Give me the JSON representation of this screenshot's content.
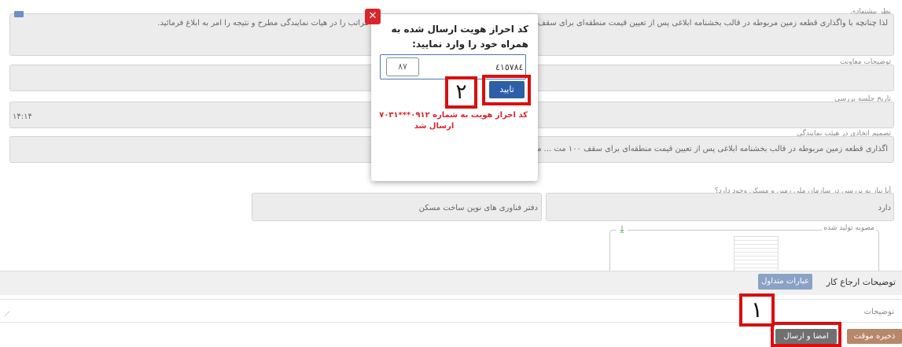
{
  "form": {
    "proposal_label": "نظر پیشنهادی",
    "proposal_text": "لذا چنانچه با واگذاری قطعه زمین مربوطه در قالب بخشنامه ابلاغی پس از تعیین قیمت منطقه‌ای برای سقف ۱۰۰ متر ... روز موافقت می‌گردد، خواهشمند است مراتب را در هیات نمایندگی مطرح و نتیجه را امر به ابلاغ فرمائید.",
    "deputy_label": "توضیحات معاونت",
    "deputy_value": "",
    "meeting_date_label": "تاریخ جلسه بررسی",
    "meeting_date_value": "۱۴:۱۴",
    "decision_label": "تصمیم اتخاذی در هیئت نمایندگی",
    "decision_text": "اگذاری قطعه زمین مربوطه در قالب بخشنامه ابلاغی پس از تعیین قیمت منطقه‌ای برای سقف ۱۰۰ مت ... می‌گردد.",
    "need_review_label": "آیا نیاز به بررسی در سازمان ملی زمین و مسکن وجود دارد؟",
    "need_review_value": "دارد",
    "office_value": "دفتر فناوری های نوین ساخت مسکن",
    "generated_label": "مصوبه تولید شده",
    "referral_label": "توضیحات ارجاع کار",
    "common_phrases_button": "عبارات متداول",
    "notes_label": "توضیحات",
    "save_draft_button": "ذخیره موقت",
    "sign_send_button": "امضا و ارسال"
  },
  "modal": {
    "title_line1": "کد احراز هویت ارسال شده به",
    "title_line2": "همراه خود را وارد نمایید:",
    "code_value": "٤١٥٧٨٤",
    "captcha_value": "۸۷",
    "confirm_button": "تایید",
    "message_line1": "کد احراز هویت به شماره ۰۹۱۲***۷۰۳۱",
    "message_line2": "ارسال شد"
  },
  "annotations": {
    "step1": "۱",
    "step2": "۲"
  },
  "colors": {
    "save_draft": "#b8876a",
    "sign_send": "#707070",
    "confirm": "#2d5fa8",
    "common_phrases": "#8aa2c6",
    "close": "#d9262b",
    "annotation_red": "#d90f0f",
    "message_red": "#d9262b"
  }
}
